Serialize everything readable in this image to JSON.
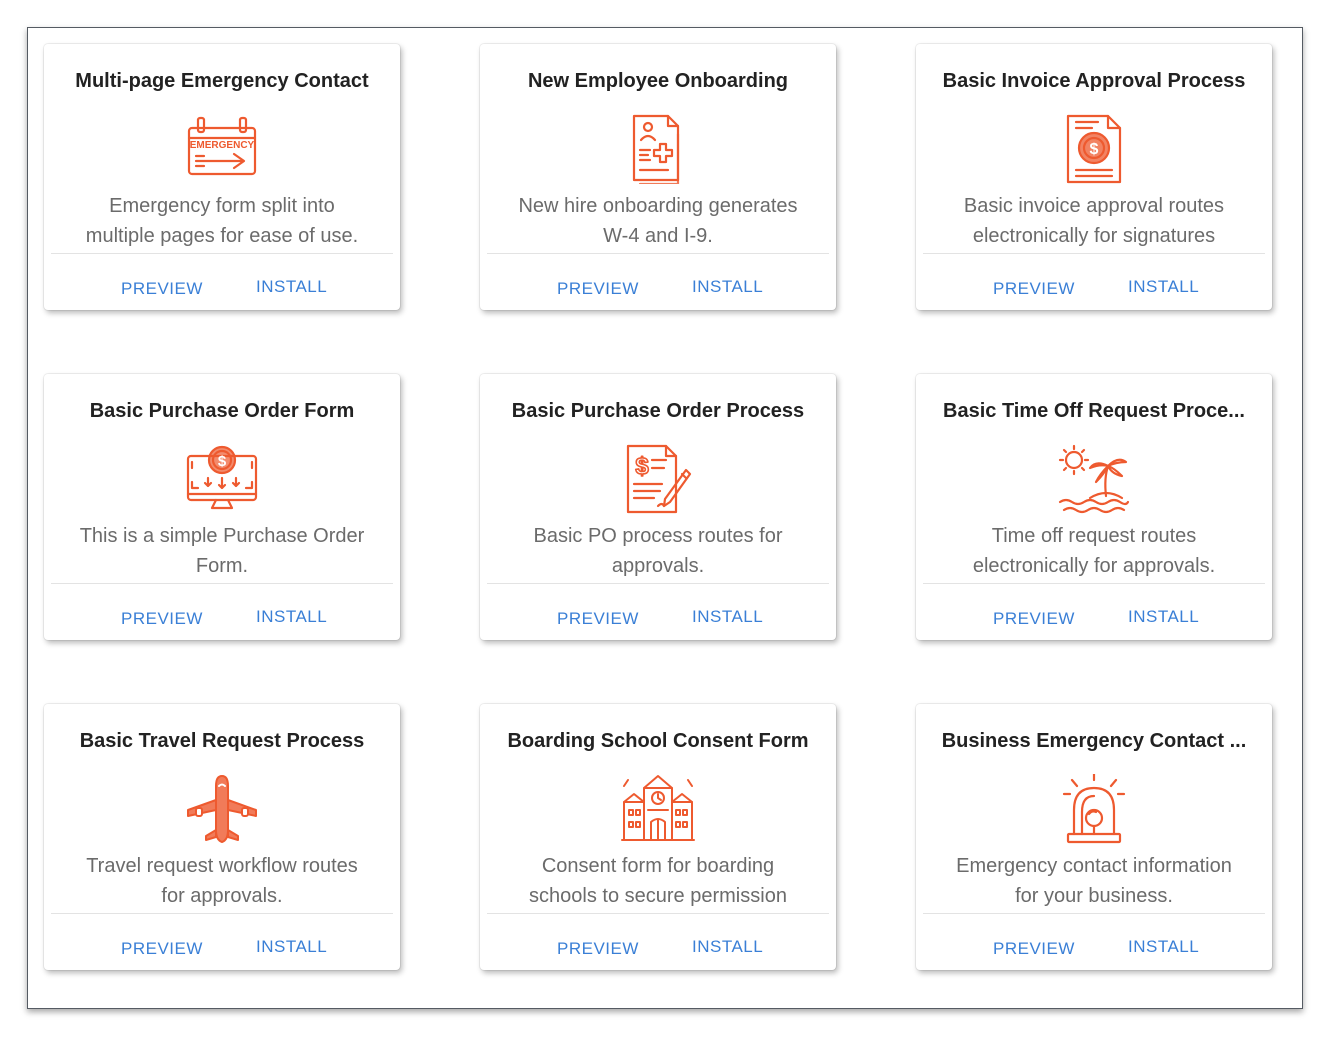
{
  "accent_color": "#ee5a2f",
  "link_color": "#3a7fd6",
  "cards": [
    {
      "title": "Multi-page Emergency Contact",
      "icon": "emergency-sign-icon",
      "desc1": "Emergency form split into",
      "desc2": "multiple pages for ease of use.",
      "preview": "PREVIEW",
      "install": "INSTALL"
    },
    {
      "title": "New Employee Onboarding",
      "icon": "medical-document-icon",
      "desc1": "New hire onboarding generates",
      "desc2": "W-4 and I-9.",
      "preview": "PREVIEW",
      "install": "INSTALL"
    },
    {
      "title": "Basic Invoice Approval Process",
      "icon": "invoice-dollar-icon",
      "desc1": "Basic invoice approval routes",
      "desc2": "electronically for signatures",
      "preview": "PREVIEW",
      "install": "INSTALL"
    },
    {
      "title": "Basic Purchase Order Form",
      "icon": "monitor-dollar-icon",
      "desc1": "This is a simple Purchase Order",
      "desc2": "Form.",
      "preview": "PREVIEW",
      "install": "INSTALL"
    },
    {
      "title": "Basic Purchase Order Process",
      "icon": "signed-document-icon",
      "desc1": "Basic PO process routes for",
      "desc2": "approvals.",
      "preview": "PREVIEW",
      "install": "INSTALL"
    },
    {
      "title": "Basic Time Off Request Proce...",
      "icon": "island-sun-icon",
      "desc1": "Time off request routes",
      "desc2": "electronically for approvals.",
      "preview": "PREVIEW",
      "install": "INSTALL"
    },
    {
      "title": "Basic Travel Request Process",
      "icon": "airplane-icon",
      "desc1": "Travel request workflow routes",
      "desc2": "for approvals.",
      "preview": "PREVIEW",
      "install": "INSTALL"
    },
    {
      "title": "Boarding School Consent Form",
      "icon": "school-building-icon",
      "desc1": "Consent form for boarding",
      "desc2": "schools to secure permission",
      "preview": "PREVIEW",
      "install": "INSTALL"
    },
    {
      "title": "Business Emergency Contact ...",
      "icon": "siren-alarm-icon",
      "desc1": "Emergency contact information",
      "desc2": "for your business.",
      "preview": "PREVIEW",
      "install": "INSTALL"
    }
  ]
}
